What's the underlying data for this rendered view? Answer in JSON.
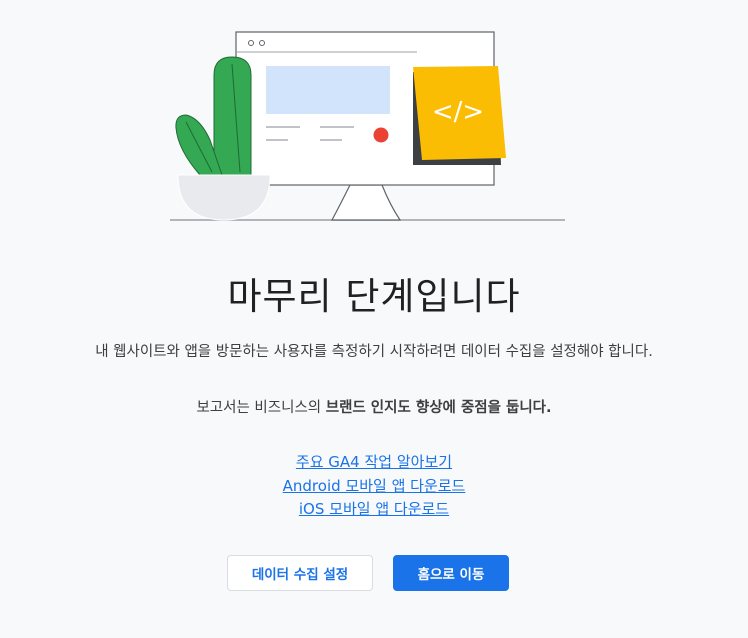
{
  "heading": {
    "title": "마무리 단계입니다"
  },
  "description": "내 웹사이트와 앱을 방문하는 사용자를 측정하기 시작하려면 데이터 수집을 설정해야 합니다.",
  "report_focus": {
    "prefix": "보고서는 비즈니스의 ",
    "bold": "브랜드 인지도 향상에 중점을 둡니다."
  },
  "links": {
    "ga4_tasks": "주요 GA4 작업 알아보기",
    "android_app": "Android 모바일 앱 다운로드",
    "ios_app": "iOS 모바일 앱 다운로드"
  },
  "buttons": {
    "data_collection_setup": "데이터 수집 설정",
    "go_home": "홈으로 이동"
  },
  "illustration": {
    "code_icon": "</>"
  },
  "colors": {
    "accent_blue": "#1a73e8",
    "monitor_blue": "#d2e3fc",
    "cactus_green": "#34a853",
    "sticky_yellow": "#fbbc04",
    "dot_red": "#ea4335"
  }
}
